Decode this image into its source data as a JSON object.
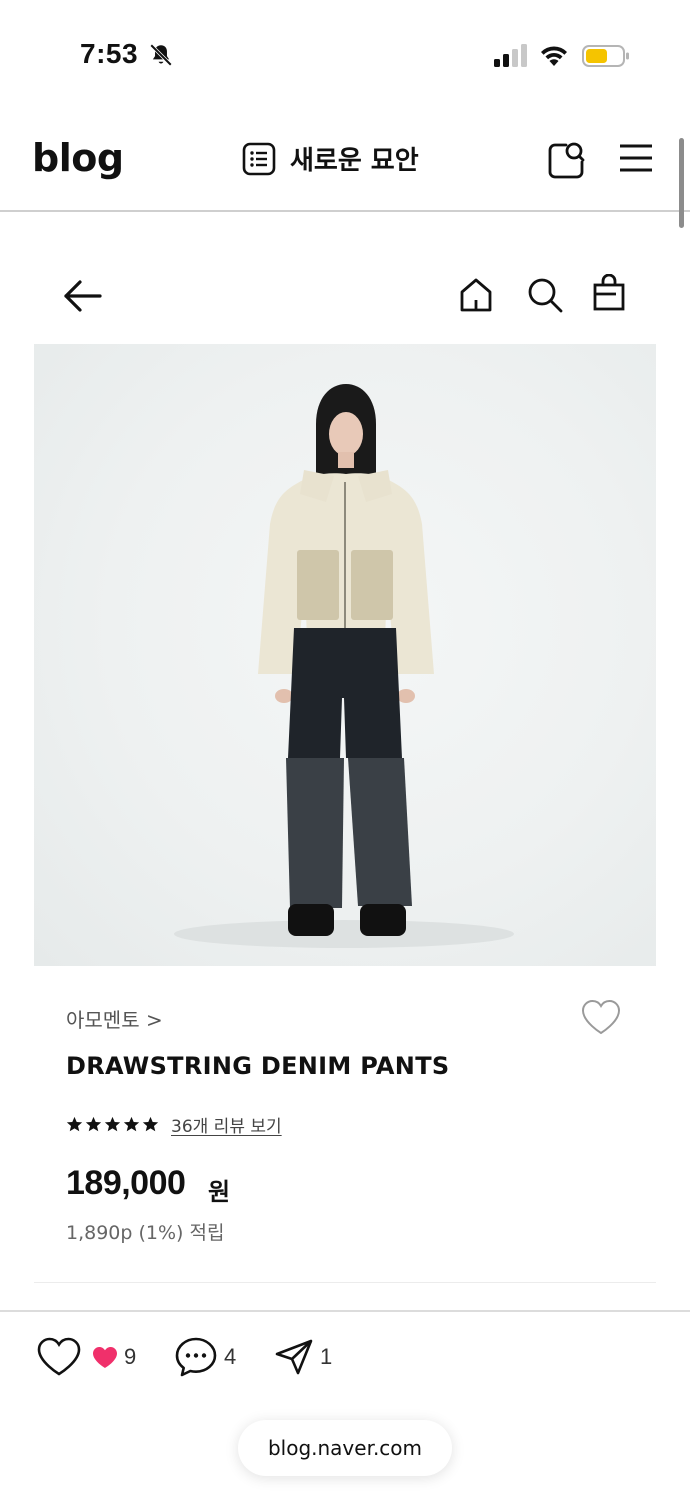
{
  "status_bar": {
    "time": "7:53",
    "icons": [
      "bell-slash-icon",
      "cellular-signal-icon",
      "wifi-icon",
      "battery-icon"
    ],
    "battery_color": "#F5C400"
  },
  "blog_header": {
    "logo": "blog",
    "post_title": "새로운 묘안",
    "icons": [
      "list-icon",
      "search-tag-icon",
      "menu-icon"
    ]
  },
  "shop_nav": {
    "icons": [
      "back-arrow-icon",
      "home-icon",
      "search-icon",
      "shopping-bag-icon"
    ]
  },
  "product": {
    "brand": "아모멘토 >",
    "name": "DRAWSTRING DENIM PANTS",
    "rating_stars": 5,
    "review_link": "36개 리뷰 보기",
    "price": "189,000",
    "price_unit": "원",
    "points": "1,890p (1%) 적립"
  },
  "reactions": {
    "like_count": "9",
    "comment_count": "4",
    "share_count": "1",
    "like_color": "#F0306B"
  },
  "browser": {
    "url": "blog.naver.com"
  }
}
